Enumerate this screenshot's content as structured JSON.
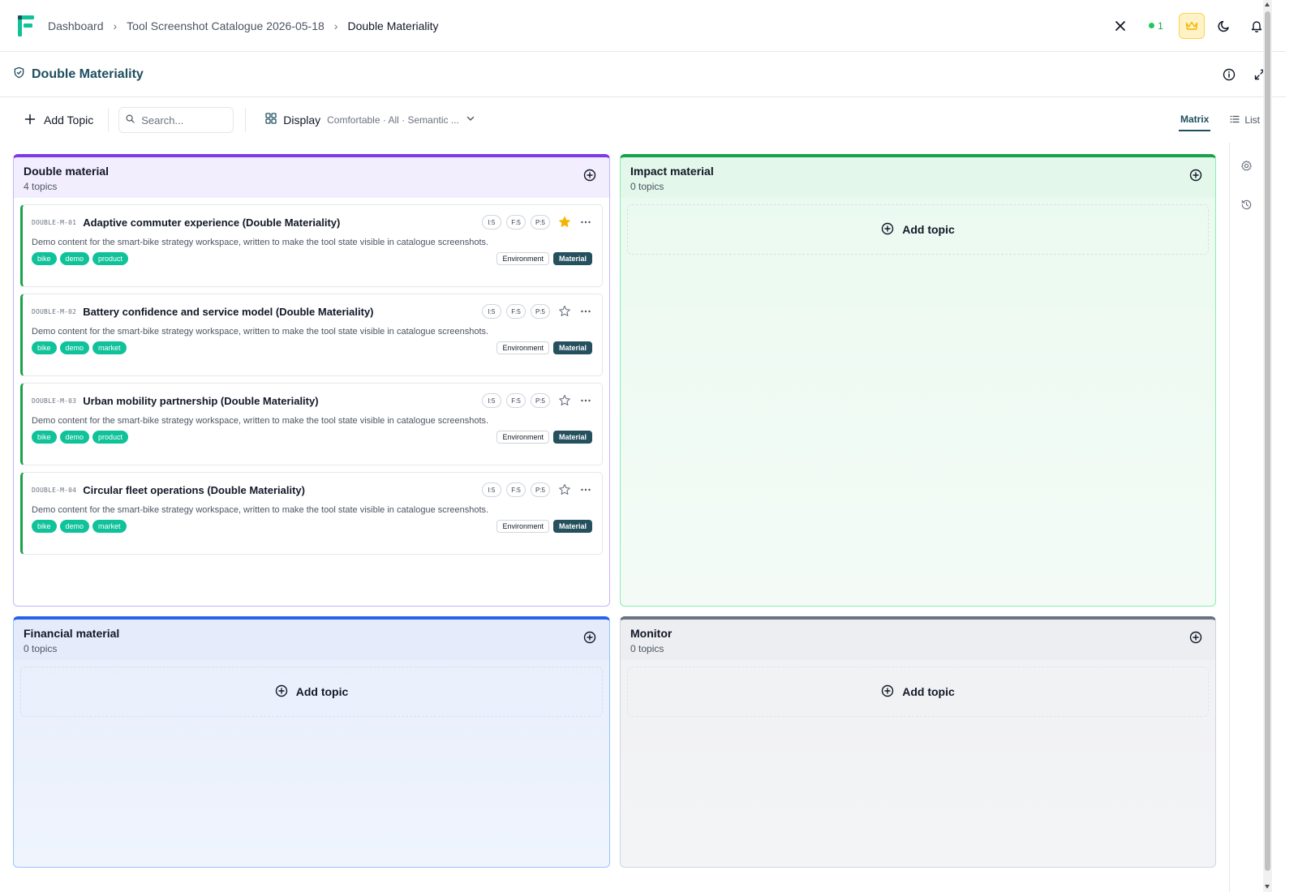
{
  "breadcrumb": [
    "Dashboard",
    "Tool Screenshot Catalogue 2026-05-18",
    "Double Materiality"
  ],
  "header": {
    "online_count": "1"
  },
  "page": {
    "title": "Double Materiality"
  },
  "toolbar": {
    "add_topic": "Add Topic",
    "search_placeholder": "Search...",
    "display_label": "Display",
    "display_summary": "Comfortable · All · Semantic ...",
    "view_matrix": "Matrix",
    "view_list": "List"
  },
  "quadrants": {
    "double": {
      "title": "Double material",
      "count": "4 topics"
    },
    "impact": {
      "title": "Impact material",
      "count": "0 topics",
      "add": "Add topic"
    },
    "financial": {
      "title": "Financial material",
      "count": "0 topics",
      "add": "Add topic"
    },
    "monitor": {
      "title": "Monitor",
      "count": "0 topics",
      "add": "Add topic"
    }
  },
  "topics": [
    {
      "code": "DOUBLE-M-01",
      "title": "Adaptive commuter experience (Double Materiality)",
      "i": "I:5",
      "f": "F:5",
      "p": "P:5",
      "starred": true,
      "desc": "Demo content for the smart-bike strategy workspace, written to make the tool state visible in catalogue screenshots.",
      "tags": [
        "bike",
        "demo",
        "product"
      ],
      "category": "Environment",
      "status": "Material"
    },
    {
      "code": "DOUBLE-M-02",
      "title": "Battery confidence and service model (Double Materiality)",
      "i": "I:5",
      "f": "F:5",
      "p": "P:5",
      "starred": false,
      "desc": "Demo content for the smart-bike strategy workspace, written to make the tool state visible in catalogue screenshots.",
      "tags": [
        "bike",
        "demo",
        "market"
      ],
      "category": "Environment",
      "status": "Material"
    },
    {
      "code": "DOUBLE-M-03",
      "title": "Urban mobility partnership (Double Materiality)",
      "i": "I:5",
      "f": "F:5",
      "p": "P:5",
      "starred": false,
      "desc": "Demo content for the smart-bike strategy workspace, written to make the tool state visible in catalogue screenshots.",
      "tags": [
        "bike",
        "demo",
        "product"
      ],
      "category": "Environment",
      "status": "Material"
    },
    {
      "code": "DOUBLE-M-04",
      "title": "Circular fleet operations (Double Materiality)",
      "i": "I:5",
      "f": "F:5",
      "p": "P:5",
      "starred": false,
      "desc": "Demo content for the smart-bike strategy workspace, written to make the tool state visible in catalogue screenshots.",
      "tags": [
        "bike",
        "demo",
        "market"
      ],
      "category": "Environment",
      "status": "Material"
    }
  ],
  "colors": {
    "brand": "#10c29a",
    "title": "#1f4e5f",
    "double": "#7c3aed",
    "impact": "#16a34a",
    "financial": "#2563eb",
    "monitor": "#6b7280",
    "star": "#f5b400"
  },
  "icons": [
    "logo-icon",
    "close-icon",
    "crown-icon",
    "moon-icon",
    "bell-icon",
    "shield-icon",
    "info-icon",
    "expand-icon",
    "plus-icon",
    "search-icon",
    "grid-icon",
    "chevron-down-icon",
    "list-icon",
    "settings-icon",
    "history-icon",
    "plus-circle-icon",
    "star-icon",
    "more-icon"
  ]
}
